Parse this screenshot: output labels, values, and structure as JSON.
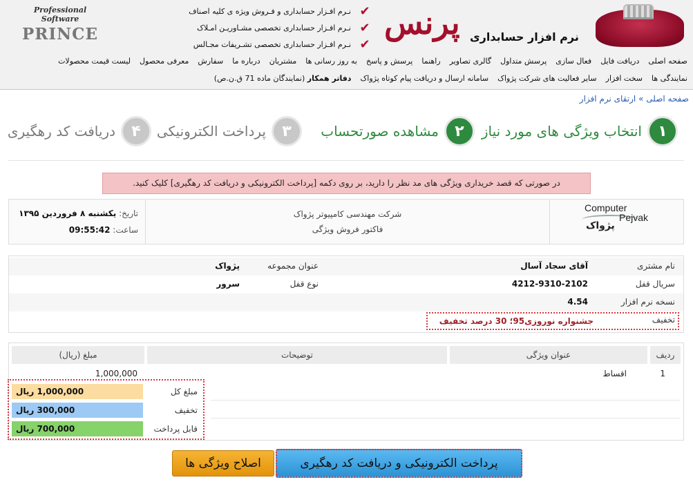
{
  "header": {
    "brand_sub": "Professional Software",
    "brand_en": "PRINCE",
    "brand_fa": "پرنس",
    "brand_tagline": "نرم افزار حسابداری",
    "features": [
      "نـرم افـزار حسابداری و فـروش ویژه ی کلیه اصناف",
      "نـرم افـزار حسابداری تخصصی  مشـاوریـن امـلاک",
      "نـرم افـزار حسابداری تخصصی تشـریفات مجـالس"
    ],
    "nav_row1": [
      "صفحه اصلی",
      "دریافت فایل",
      "فعال سازی",
      "پرسش متداول",
      "گالری تصاویر",
      "راهنما",
      "پرسش و پاسخ",
      "به روز رسانی ها",
      "مشتریان",
      "درباره ما",
      "سفارش",
      "معرفی محصول",
      "لیست قیمت محصولات"
    ],
    "nav_row2": [
      "نمایندگی ها",
      "سخت افزار",
      "سایر فعالیت های شرکت پژواک",
      "سامانه ارسال و دریافت پیام کوتاه پژواک"
    ],
    "nav_row2_bold": "دفاتر همکار",
    "nav_row2_last": "(نمایندگان ماده 71 ق.ن.ص)"
  },
  "breadcrumb": {
    "home": "صفحه اصلی",
    "separator": "»",
    "current": "ارتقای نرم افزار"
  },
  "steps": [
    {
      "num": "۱",
      "label": "انتخاب ویژگی های مورد نیاز",
      "state": "active"
    },
    {
      "num": "۲",
      "label": "مشاهده صورتحساب",
      "state": "active"
    },
    {
      "num": "۳",
      "label": "پرداخت الکترونیکی",
      "state": "inactive"
    },
    {
      "num": "۴",
      "label": "دریافت کد رهگیری",
      "state": "inactive"
    }
  ],
  "alert": "در صورتی که قصد خریداری ویژگی های مد نظر را دارید، بر روی دکمه [پرداخت الکترونیکی و دریافت کد رهگیری] کلیک کنید.",
  "invoice_head": {
    "date_label": "تاریخ:",
    "date_value": "یکشنبه ۸ فروردین ۱۳۹۵",
    "time_label": "ساعت:",
    "time_value": "09:55:42",
    "company": "شرکت مهندسی کامپیوتر پژواک",
    "invoice_title": "فاکتور فروش ویژگی",
    "logo_line1": "Computer",
    "logo_line2": "Pejvak",
    "logo_fa": "پژواک"
  },
  "customer": {
    "name_label": "نام مشتری",
    "name_value": "آقای سجاد آسال",
    "group_label": "عنوان مجموعه",
    "group_value": "پژواک",
    "serial_label": "سریال قفل",
    "serial_value": "4212-9310-2102",
    "lock_label": "نوع قفل",
    "lock_value": "سرور",
    "version_label": "نسخه نرم افزار",
    "version_value": "4.54",
    "discount_label": "تخفیف",
    "discount_value": "جشنواره نوروزی95؛ 30 درصد تخفیف"
  },
  "items": {
    "headers": {
      "row": "ردیف",
      "title": "عنوان ویژگی",
      "desc": "توضیحات",
      "amount": "مبلغ (ریال)"
    },
    "rows": [
      {
        "row": "1",
        "title": "اقساط",
        "desc": "",
        "amount": "1,000,000"
      }
    ]
  },
  "totals": {
    "total_label": "مبلغ کل",
    "total_value": "1,000,000 ریال",
    "discount_label": "تخفیف",
    "discount_value": "300,000 ریال",
    "payable_label": "قابل پرداخت",
    "payable_value": "700,000 ریال"
  },
  "buttons": {
    "pay": "پرداخت الکترونیکی و دریافت کد رهگیری",
    "edit": "اصلاح ویژگی ها"
  },
  "colors": {
    "brand_red": "#a3102c",
    "step_active": "#2e8a3e",
    "step_inactive": "#c8c8c8",
    "alert_bg": "#f4c3c5",
    "link": "#2a5db0",
    "total_bg": "#fcdca0",
    "discount_bg": "#9ccaf5",
    "payable_bg": "#86d26b",
    "pay_button": "#2c93d4",
    "edit_button": "#e3930b"
  },
  "icons": {
    "feature_check": "checkmark-icon",
    "crown": "crown-icon"
  }
}
